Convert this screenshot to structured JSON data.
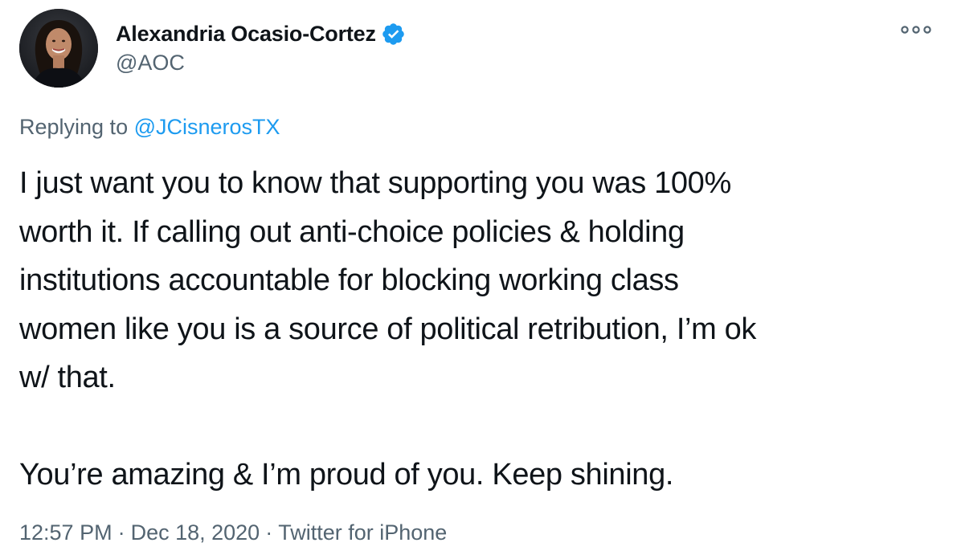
{
  "author": {
    "display_name": "Alexandria Ocasio-Cortez",
    "handle": "@AOC",
    "verified": true,
    "avatar_icon": "profile-photo"
  },
  "reply": {
    "prefix": "Replying to",
    "target_handle": "@JCisnerosTX"
  },
  "body": {
    "lines": [
      "I just want you to know that supporting you was 100%",
      "worth it. If calling out anti-choice policies & holding",
      "institutions accountable for blocking working class",
      "women like you is a source of political retribution, I’m ok",
      "w/ that.",
      "",
      "You’re amazing & I’m proud of you. Keep shining."
    ]
  },
  "meta": {
    "time": "12:57 PM",
    "separator": "·",
    "date": "Dec 18, 2020",
    "source": "Twitter for iPhone"
  },
  "menu": {
    "more_icon": "more-horizontal-icon"
  },
  "colors": {
    "text": "#0f1419",
    "secondary": "#536471",
    "link": "#1d9bf0",
    "verified": "#1d9bf0",
    "background": "#ffffff"
  }
}
